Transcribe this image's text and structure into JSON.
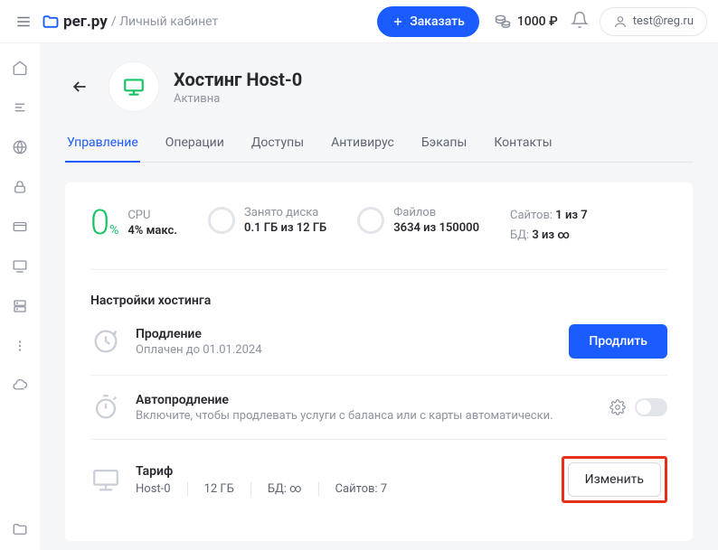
{
  "logo": "рег.ру",
  "breadcrumb": "/ Личный кабинет",
  "order_btn": "Заказать",
  "balance": "1000 ₽",
  "user_email": "test@reg.ru",
  "page_title": "Хостинг Host-0",
  "status": "Активна",
  "tabs": [
    "Управление",
    "Операции",
    "Доступы",
    "Антивирус",
    "Бэкапы",
    "Контакты"
  ],
  "stats": {
    "cpu": {
      "label": "CPU",
      "value": "4% макс.",
      "big": "0",
      "unit": "%"
    },
    "disk": {
      "label": "Занято диска",
      "value": "0.1 ГБ из 12 ГБ"
    },
    "files": {
      "label": "Файлов",
      "value": "3634 из 150000"
    },
    "sites": {
      "k": "Сайтов:",
      "v": "1 из 7"
    },
    "db": {
      "k": "БД:",
      "v": "3 из ∞"
    }
  },
  "section_title": "Настройки хостинга",
  "settings": {
    "renew": {
      "title": "Продление",
      "sub": "Оплачен до 01.01.2024",
      "btn": "Продлить"
    },
    "auto": {
      "title": "Автопродление",
      "sub": "Включите, чтобы продлевать услуги с баланса или с карты автоматически."
    },
    "tariff": {
      "title": "Тариф",
      "btn": "Изменить",
      "meta": [
        "Host-0",
        "12 ГБ",
        "БД: ∞",
        "Сайтов: 7"
      ]
    }
  }
}
